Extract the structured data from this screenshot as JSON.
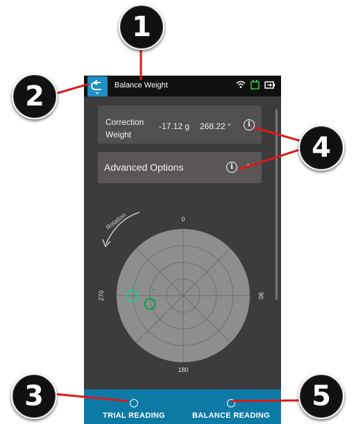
{
  "header": {
    "title": "Balance Weight"
  },
  "correction": {
    "label": "Correction Weight",
    "grams": "-17.12 g",
    "angle": "268.22 °"
  },
  "advanced": {
    "label": "Advanced Options"
  },
  "polar": {
    "labels": {
      "top": "0",
      "right": "90",
      "bottom": "180",
      "left": "270"
    },
    "rotation_label": "Rotation",
    "markers": [
      {
        "label": "I",
        "color": "#2ec48a"
      },
      {
        "label": "T",
        "color": "#1f9a56"
      }
    ]
  },
  "bottom": {
    "trial": "TRIAL READING",
    "balance": "BALANCE READING"
  },
  "callouts": [
    "1",
    "2",
    "3",
    "4",
    "5"
  ],
  "colors": {
    "accent": "#1f8fc4",
    "bottom_bar": "#0d7aa6",
    "callout_line": "#e01818"
  }
}
